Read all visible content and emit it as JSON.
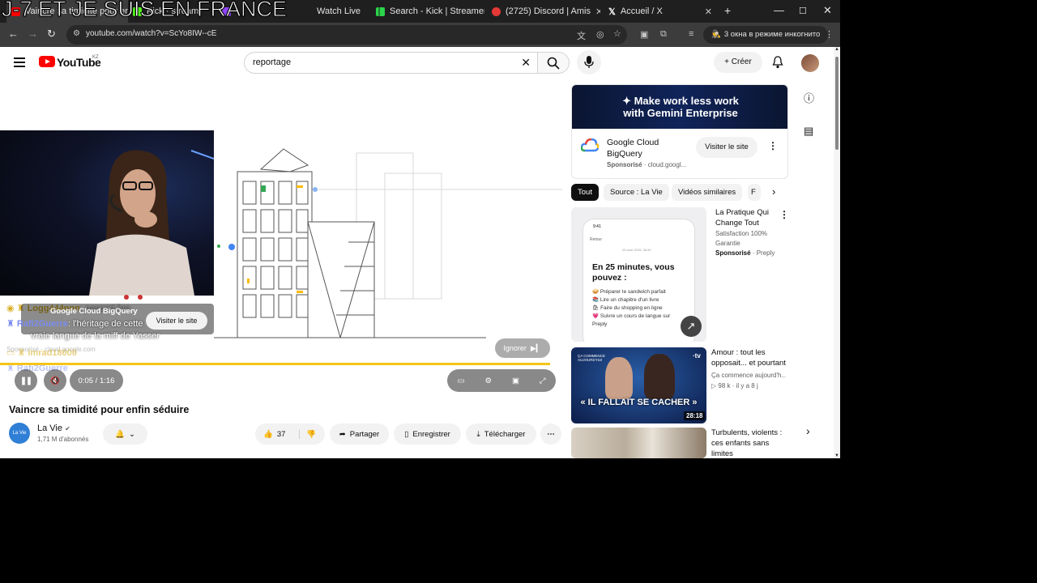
{
  "stream_overlay": {
    "caption": "J-7 ET JE SUIS EN FRANCE"
  },
  "browser": {
    "tabs": [
      {
        "title": "Vaincre sa timidité pour enfin séduire",
        "active": true
      },
      {
        "title": "Kick · stream"
      },
      {
        "title": "Watch Live"
      },
      {
        "title": "Search - Kick | StreamerSta"
      },
      {
        "title": "(2725) Discord | Amis"
      },
      {
        "title": "Accueil / X"
      }
    ],
    "new_tab": "+",
    "url": "youtube.com/watch?v=ScYo8IW--cE",
    "incognito_label": "3 окна в режиме инкогнито"
  },
  "youtube": {
    "logo_text": "YouTube",
    "country_code": "KZ",
    "search_value": "reportage",
    "create_label": "Créer"
  },
  "player": {
    "ad_sponsor": "Google Cloud BigQuery",
    "ad_visit_label": "Visiter le site",
    "skip_label": "Ignorer",
    "time": "0:05 / 1:16",
    "sponsored_label": "Sponsorisé · cloud.google.com",
    "progress_fraction": 0.99,
    "chat": [
      {
        "user": "Logg444nnn",
        "message": ": pasport bro",
        "color": "#d8b02a"
      },
      {
        "user": "Rafi2Guerre",
        "message": ": l'héritage de cette",
        "color": "#7b8cf0"
      },
      {
        "user": "",
        "message": "vraie langue de la miff de Yasser",
        "color": "#ffffff"
      },
      {
        "user": "imrad18000",
        "message": ": ",
        "color": "#d8b02a"
      },
      {
        "user": "Rafi2Guerre",
        "message": ": ",
        "color": "#7b8cf0"
      }
    ]
  },
  "video": {
    "title": "Vaincre sa timidité pour enfin séduire",
    "channel_name": "La Vie",
    "channel_avatar_text": "La Vie",
    "subscribers": "1,71 M d'abonnés",
    "likes": "37",
    "share_label": "Partager",
    "save_label": "Enregistrer",
    "download_label": "Télécharger"
  },
  "sidebar": {
    "ad": {
      "banner_line1": "✦ Make work less work",
      "banner_line2": "with Gemini Enterprise",
      "name": "Google Cloud BigQuery",
      "sponsored": "Sponsorisé",
      "domain": "cloud.googl...",
      "visit_label": "Visiter le site"
    },
    "chips": [
      "Tout",
      "Source : La Vie",
      "Vidéos similaires",
      "F"
    ],
    "cards": [
      {
        "title": "La Pratique Qui Change Tout",
        "meta1": "Satisfaction 100%",
        "meta2": "Garantie",
        "sponsored": "Sponsorisé",
        "source": "Preply",
        "thumb_heading": "En 25 minutes, vous pouvez :",
        "thumb_time": "9:41",
        "thumb_back": "Retour",
        "thumb_date": "25 août 2025, 08:30",
        "thumb_items": [
          "Préparer le sandwich parfait",
          "Lire un chapitre d'un livre",
          "Faire du shopping en ligne",
          "Suivre un cours de langue sur Preply"
        ]
      },
      {
        "title": "Amour : tout les opposait... et pourtant",
        "meta1": "Ça commence aujourd'h...",
        "views": "98 k",
        "age": "il y a 8 j",
        "thumb_caption": "« IL FALLAIT SE CACHER »",
        "thumb_badge": "ÇA COMMENCE AUJOURD'HUI",
        "duration": "28:18"
      },
      {
        "title": "Turbulents, violents : ces enfants sans limites"
      }
    ]
  },
  "colors": {
    "youtube_red": "#ff0000",
    "progress": "#f5c518",
    "tab_bg": "#1f1f1f",
    "toolbar_bg": "#3c3c3c"
  }
}
